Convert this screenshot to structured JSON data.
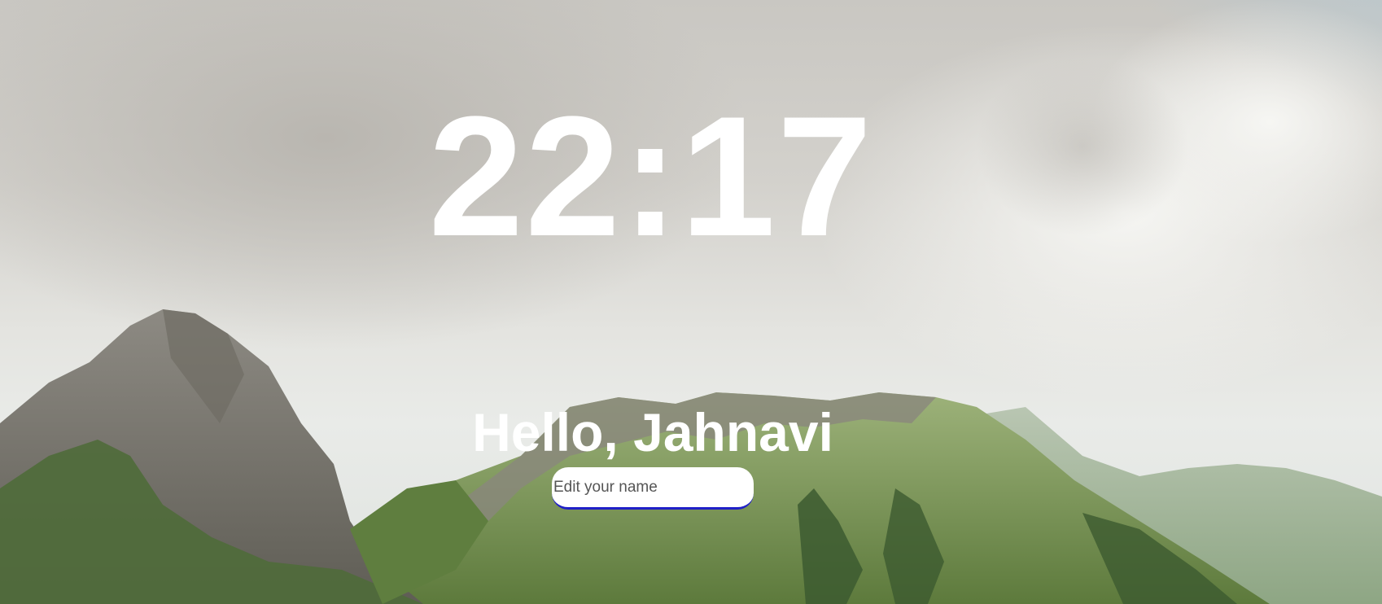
{
  "clock": {
    "time": "22:17"
  },
  "greeting": {
    "text": "Hello, Jahnavi"
  },
  "name_input": {
    "placeholder": "Edit your name",
    "value": ""
  },
  "colors": {
    "sky": "#cfcdc8",
    "blue_sky": "#b3cfdc",
    "cloud": "#f2f2ef",
    "rock": "#8e8a82",
    "grass": "#7f9a5a",
    "forest": "#3e5a32",
    "text": "#ffffff",
    "input_border": "#1f1fc7"
  }
}
